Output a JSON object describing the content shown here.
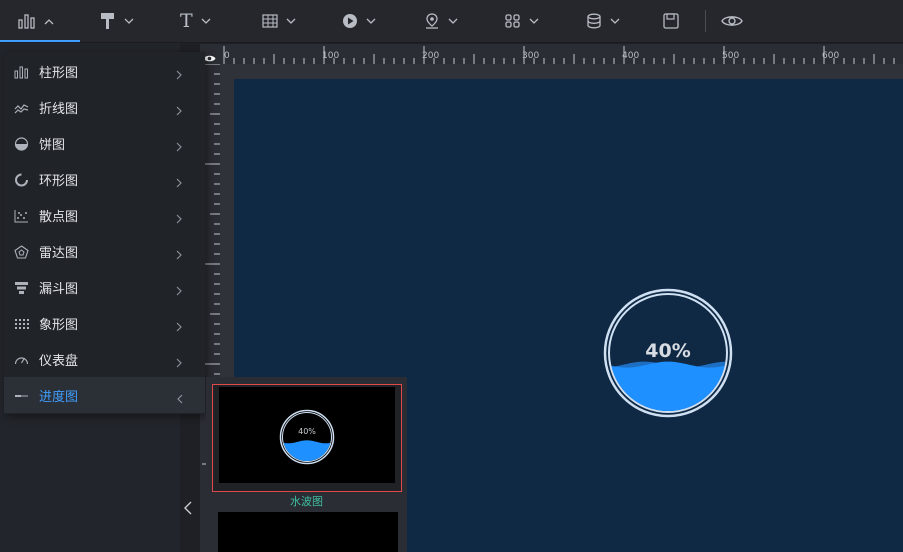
{
  "toolbar": {
    "items": [
      {
        "icon": "bar-chart-icon",
        "caret": "up"
      },
      {
        "icon": "paint-brush-icon",
        "caret": "down"
      },
      {
        "icon": "text-icon",
        "glyph": "T",
        "caret": "down"
      },
      {
        "icon": "table-icon",
        "caret": "down"
      },
      {
        "icon": "play-circle-icon",
        "caret": "down"
      },
      {
        "icon": "map-pin-icon",
        "caret": "down"
      },
      {
        "icon": "grid-icon",
        "caret": "down"
      },
      {
        "icon": "database-icon",
        "caret": "down"
      }
    ],
    "save_icon": "save-icon",
    "preview_icon": "eye-icon",
    "accent_color": "#409eff"
  },
  "menu": {
    "items": [
      {
        "label": "柱形图",
        "icon": "bar-chart-icon"
      },
      {
        "label": "折线图",
        "icon": "line-chart-icon"
      },
      {
        "label": "饼图",
        "icon": "pie-chart-icon"
      },
      {
        "label": "环形图",
        "icon": "ring-chart-icon"
      },
      {
        "label": "散点图",
        "icon": "scatter-chart-icon"
      },
      {
        "label": "雷达图",
        "icon": "radar-chart-icon"
      },
      {
        "label": "漏斗图",
        "icon": "funnel-chart-icon"
      },
      {
        "label": "象形图",
        "icon": "pictorial-chart-icon"
      },
      {
        "label": "仪表盘",
        "icon": "gauge-icon"
      },
      {
        "label": "进度图",
        "icon": "progress-icon",
        "active": true
      }
    ]
  },
  "ruler": {
    "top_labels": [
      "0",
      "100",
      "200",
      "300",
      "400",
      "500",
      "600"
    ],
    "left_labels": [
      "100",
      "200",
      "300"
    ]
  },
  "widget": {
    "value_text": "40%",
    "fill_fraction": 0.4,
    "wave_color": "#1e90ff",
    "canvas_color": "#0f2843"
  },
  "submenu": {
    "items": [
      {
        "label": "水波图",
        "preview_text": "40%"
      }
    ]
  }
}
